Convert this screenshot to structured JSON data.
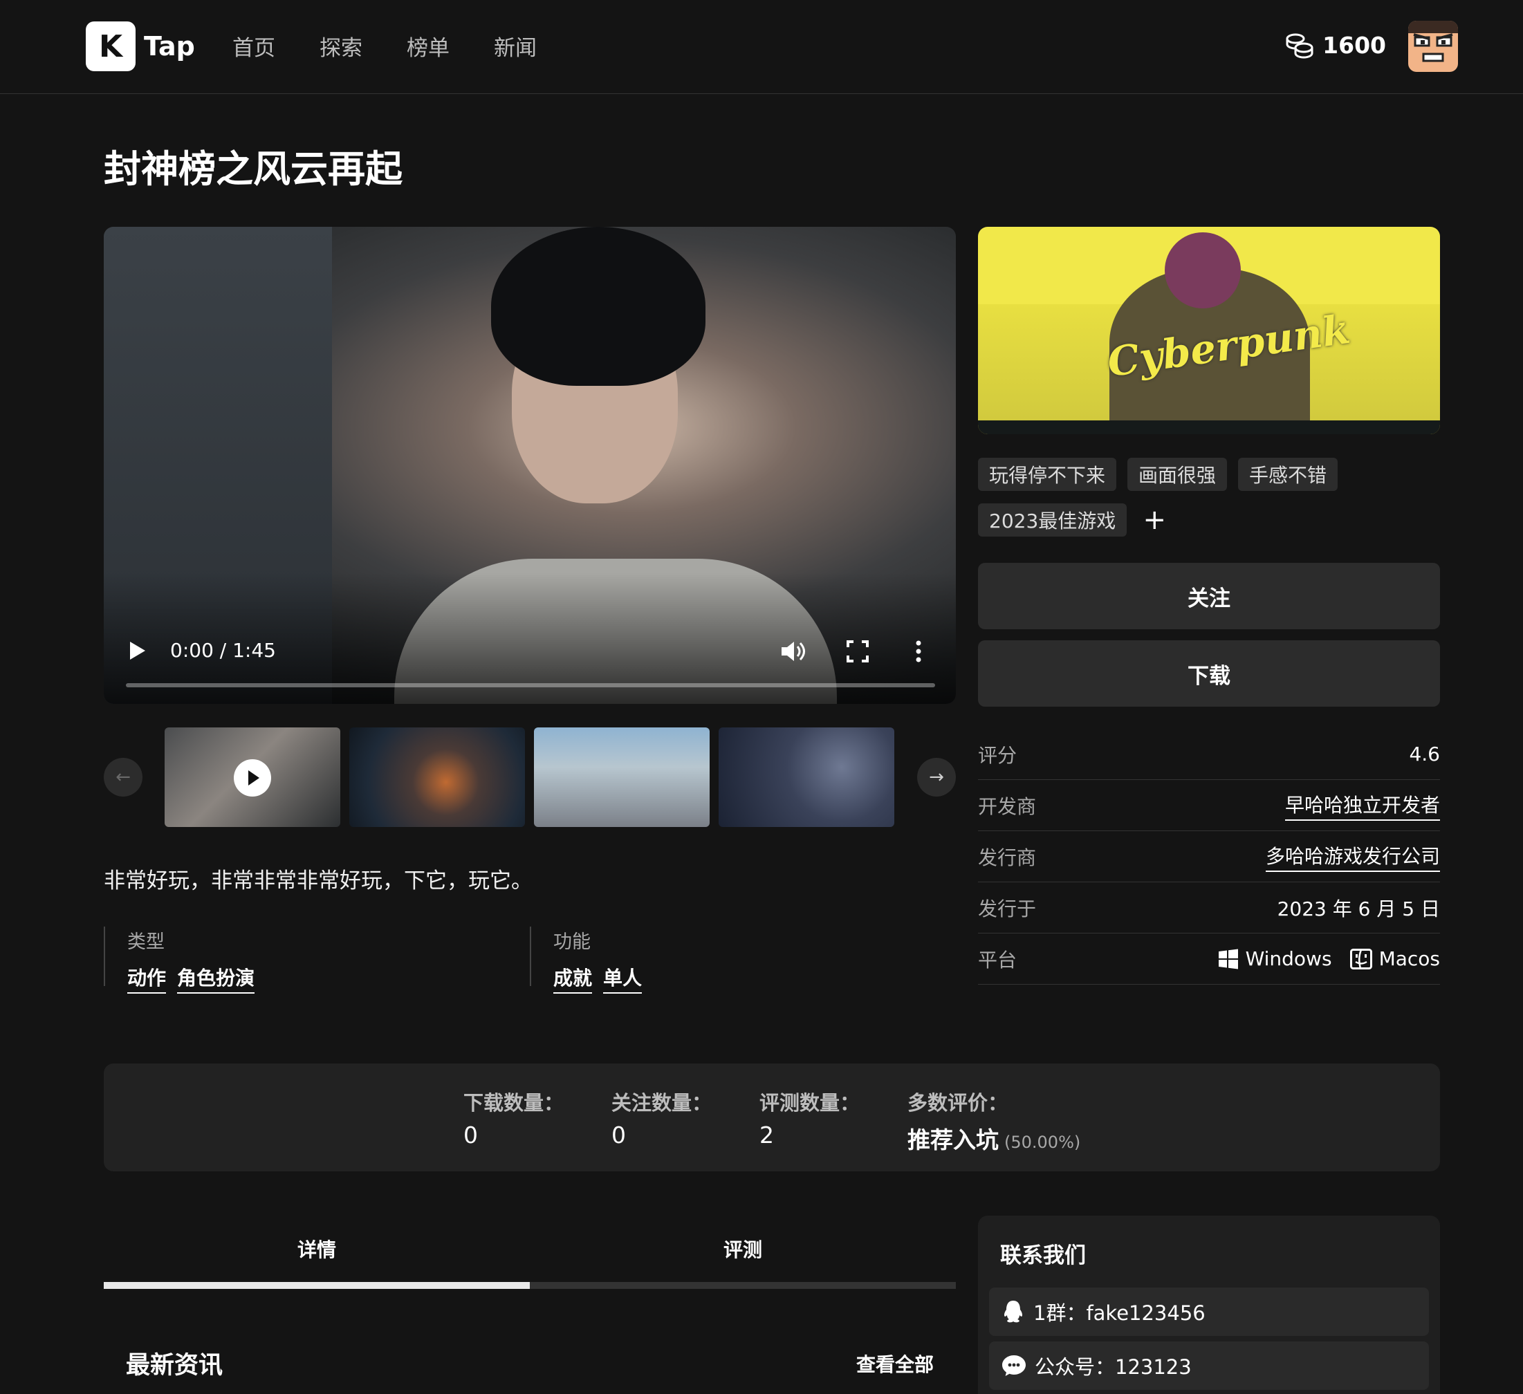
{
  "header": {
    "logo_letter": "K",
    "logo_text": "Tap",
    "nav": [
      "首页",
      "探索",
      "榜单",
      "新闻"
    ],
    "coins": "1600"
  },
  "game": {
    "title": "封神榜之风云再起",
    "description": "非常好玩，非常非常非常好玩，下它，玩它。"
  },
  "video": {
    "time": "0:00 / 1:45",
    "progress": 0
  },
  "cover": {
    "logo_text": "Cyberpunk"
  },
  "tags": [
    "玩得停不下来",
    "画面很强",
    "手感不错",
    "2023最佳游戏"
  ],
  "add_tag_label": "+",
  "buttons": {
    "follow": "关注",
    "download": "下载"
  },
  "info": {
    "rating_label": "评分",
    "rating": "4.6",
    "developer_label": "开发商",
    "developer": "早哈哈独立开发者",
    "publisher_label": "发行商",
    "publisher": "多哈哈游戏发行公司",
    "release_label": "发行于",
    "release": "2023 年 6 月 5 日",
    "platform_label": "平台",
    "platforms": [
      "Windows",
      "Macos"
    ]
  },
  "meta": {
    "genre_label": "类型",
    "genres": [
      "动作",
      "角色扮演"
    ],
    "feature_label": "功能",
    "features": [
      "成就",
      "单人"
    ]
  },
  "stats": {
    "downloads_label": "下载数量：",
    "downloads": "0",
    "follows_label": "关注数量：",
    "follows": "0",
    "reviews_label": "评测数量：",
    "reviews": "2",
    "majority_label": "多数评价：",
    "majority": "推荐入坑",
    "majority_pct": "(50.00%)"
  },
  "tabs": [
    "详情",
    "评测"
  ],
  "tab_active_fraction": 0.5,
  "news": {
    "title": "最新资讯",
    "view_all": "查看全部"
  },
  "contact": {
    "title": "联系我们",
    "rows": [
      {
        "icon": "qq-icon",
        "text": "1群：fake123456"
      },
      {
        "icon": "wechat-icon",
        "text": "公众号：123123"
      }
    ]
  },
  "colors": {
    "background": "#141414",
    "panel": "#2c2c2c",
    "cover_yellow": "#f1e84a"
  }
}
